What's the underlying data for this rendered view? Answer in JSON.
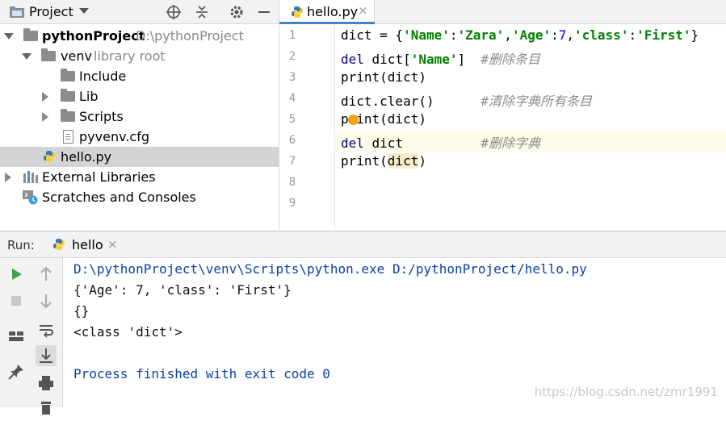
{
  "project_panel": {
    "title": "Project",
    "tree": {
      "root_name": "pythonProject",
      "root_path": "D:\\pythonProject",
      "venv_name": "venv",
      "venv_tag": "library root",
      "include": "Include",
      "lib": "Lib",
      "scripts": "Scripts",
      "cfg": "pyvenv.cfg",
      "hello_file": "hello.py",
      "external": "External Libraries",
      "scratches": "Scratches and Consoles"
    }
  },
  "editor": {
    "tab_label": "hello.py",
    "line_numbers": [
      "1",
      "2",
      "3",
      "4",
      "5",
      "6",
      "7",
      "8",
      "9"
    ],
    "lines": {
      "l1": {
        "a": "dict = {",
        "b": "'Name'",
        "c": ":",
        "d": "'Zara'",
        "e": ",",
        "f": "'Age'",
        "g": ":",
        "h": "7",
        "i": ",",
        "j": "'class'",
        "k": ":",
        "l": "'First'",
        "m": "}"
      },
      "l2": {
        "a": "del",
        "b": " dict[",
        "c": "'Name'",
        "d": "]  ",
        "e": "#删除条目"
      },
      "l3": {
        "a": "print(dict)"
      },
      "l4": {
        "a": "dict.clear()      ",
        "b": "#清除字典所有条目"
      },
      "l5": {
        "a": "print(dict)"
      },
      "l6": {
        "a": "del",
        "b": " dict          ",
        "c": "#删除字典"
      },
      "l7": {
        "a": "print(",
        "b": "dict",
        "c": ")"
      }
    }
  },
  "run_panel": {
    "label": "Run:",
    "tab_label": "hello",
    "console": [
      "D:\\pythonProject\\venv\\Scripts\\python.exe D:/pythonProject/hello.py",
      "{'Age': 7, 'class': 'First'}",
      "{}",
      "<class 'dict'>",
      "",
      "Process finished with exit code 0"
    ]
  },
  "watermark": "https://blog.csdn.net/zmr1991"
}
